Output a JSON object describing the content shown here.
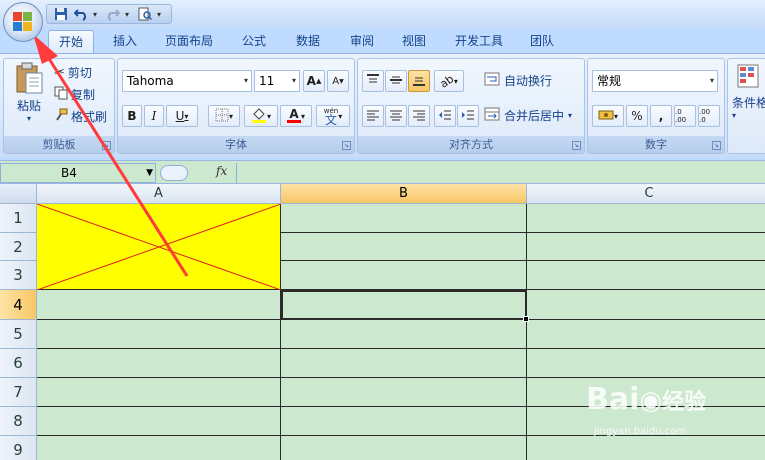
{
  "ribbon_tabs": [
    "开始",
    "插入",
    "页面布局",
    "公式",
    "数据",
    "审阅",
    "视图",
    "开发工具",
    "团队"
  ],
  "clipboard": {
    "paste": "粘贴",
    "cut": "剪切",
    "copy": "复制",
    "format_painter": "格式刷",
    "label": "剪贴板"
  },
  "font": {
    "name": "Tahoma",
    "size": "11",
    "bold": "B",
    "italic": "I",
    "underline": "U",
    "grow": "A",
    "shrink": "A",
    "font_color_glyph": "A",
    "phonetic": "wén",
    "label": "字体"
  },
  "alignment": {
    "wrap_text": "自动换行",
    "merge_center": "合并后居中",
    "label": "对齐方式"
  },
  "number": {
    "format": "常规",
    "percent": "%",
    "comma": ",",
    "increase_decimal": ".0 .00",
    "decrease_decimal": ".00 .0",
    "label": "数字"
  },
  "styles": {
    "conditional_formatting": "条件格"
  },
  "formula_bar": {
    "name_box": "B4",
    "fx": "fx"
  },
  "columns": [
    "A",
    "B",
    "C"
  ],
  "rows": [
    "1",
    "2",
    "3",
    "4",
    "5",
    "6",
    "7",
    "8",
    "9"
  ],
  "active_cell": "B4",
  "colors": {
    "merged_fill": "#ffff00",
    "grid_bg": "#cce8cf",
    "arrow": "#ff3b3b",
    "diagonal": "#ff0000"
  },
  "watermark": {
    "logo": "Bai",
    "logo2": "经验",
    "url": "jingyan.baidu.com"
  }
}
